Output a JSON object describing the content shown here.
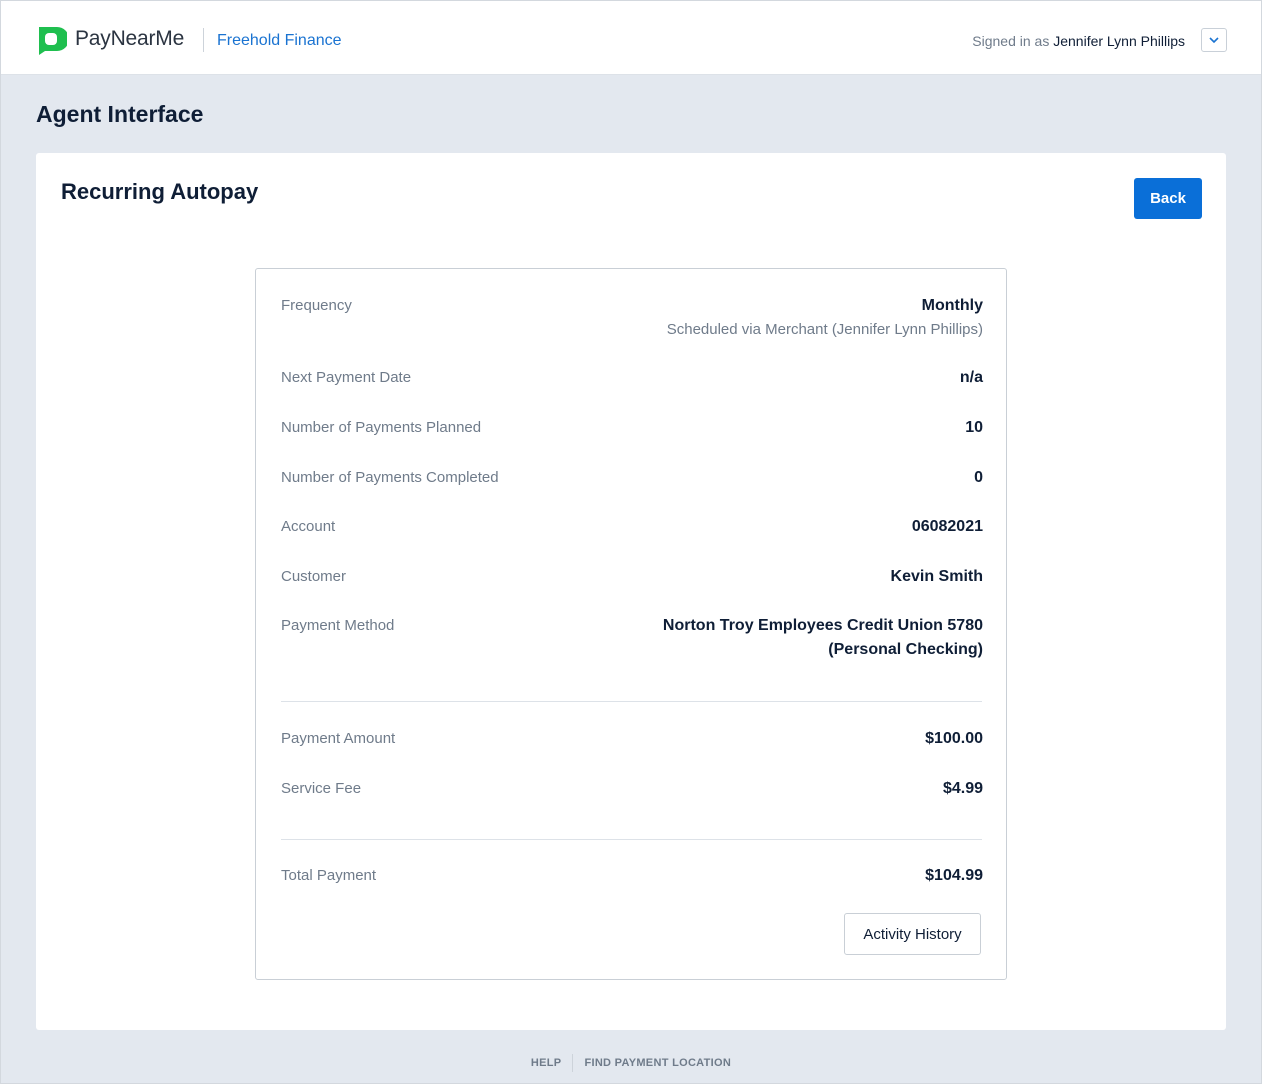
{
  "header": {
    "brand": "PayNearMe",
    "merchant": "Freehold Finance",
    "signed_in_prefix": "Signed in as",
    "user_name": "Jennifer Lynn Phillips",
    "menu_icon": "chevron-down-icon",
    "logo_color": "#1fbf4f"
  },
  "page": {
    "title": "Agent Interface"
  },
  "card": {
    "title": "Recurring Autopay",
    "back_label": "Back"
  },
  "details": {
    "frequency": {
      "label": "Frequency",
      "value": "Monthly",
      "sub": "Scheduled via Merchant (Jennifer Lynn Phillips)"
    },
    "next_payment_date": {
      "label": "Next Payment Date",
      "value": "n/a"
    },
    "payments_planned": {
      "label": "Number of Payments Planned",
      "value": "10"
    },
    "payments_completed": {
      "label": "Number of Payments Completed",
      "value": "0"
    },
    "account": {
      "label": "Account",
      "value": "06082021"
    },
    "customer": {
      "label": "Customer",
      "value": "Kevin Smith"
    },
    "payment_method": {
      "label": "Payment Method",
      "value_line1": "Norton Troy Employees Credit Union 5780",
      "value_line2": "(Personal Checking)"
    },
    "payment_amount": {
      "label": "Payment Amount",
      "value": "$100.00"
    },
    "service_fee": {
      "label": "Service Fee",
      "value": "$4.99"
    },
    "total_payment": {
      "label": "Total Payment",
      "value": "$104.99"
    },
    "activity_history_label": "Activity History"
  },
  "footer": {
    "help": "HELP",
    "find_location": "FIND PAYMENT LOCATION"
  },
  "colors": {
    "accent": "#0a6fd8",
    "merchant_link": "#1a73d1",
    "background": "#e3e8ef"
  }
}
